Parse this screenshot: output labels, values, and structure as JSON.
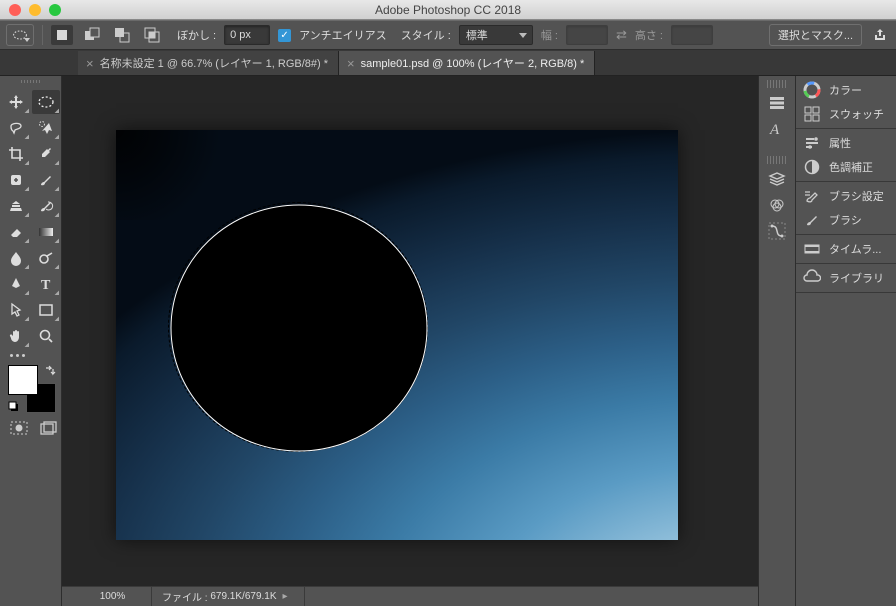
{
  "app": {
    "title": "Adobe Photoshop CC 2018"
  },
  "options": {
    "feather_label": "ぼかし :",
    "feather_value": "0 px",
    "antialias_label": "アンチエイリアス",
    "style_label": "スタイル :",
    "style_value": "標準",
    "width_label": "幅 :",
    "height_label": "高さ :",
    "select_mask_label": "選択とマスク..."
  },
  "tabs": [
    {
      "label": "名称未設定 1 @ 66.7% (レイヤー 1, RGB/8#) *",
      "active": false
    },
    {
      "label": "sample01.psd @ 100% (レイヤー 2, RGB/8) *",
      "active": true
    }
  ],
  "status": {
    "zoom": "100%",
    "file_label": "ファイル :",
    "file_value": "679.1K/679.1K"
  },
  "panels": {
    "color": "カラー",
    "swatches": "スウォッチ",
    "properties": "属性",
    "adjustments": "色調補正",
    "brush_settings": "ブラシ設定",
    "brush": "ブラシ",
    "timeline": "タイムラ...",
    "library": "ライブラリ"
  },
  "colors": {
    "foreground": "#ffffff",
    "background": "#000000"
  }
}
